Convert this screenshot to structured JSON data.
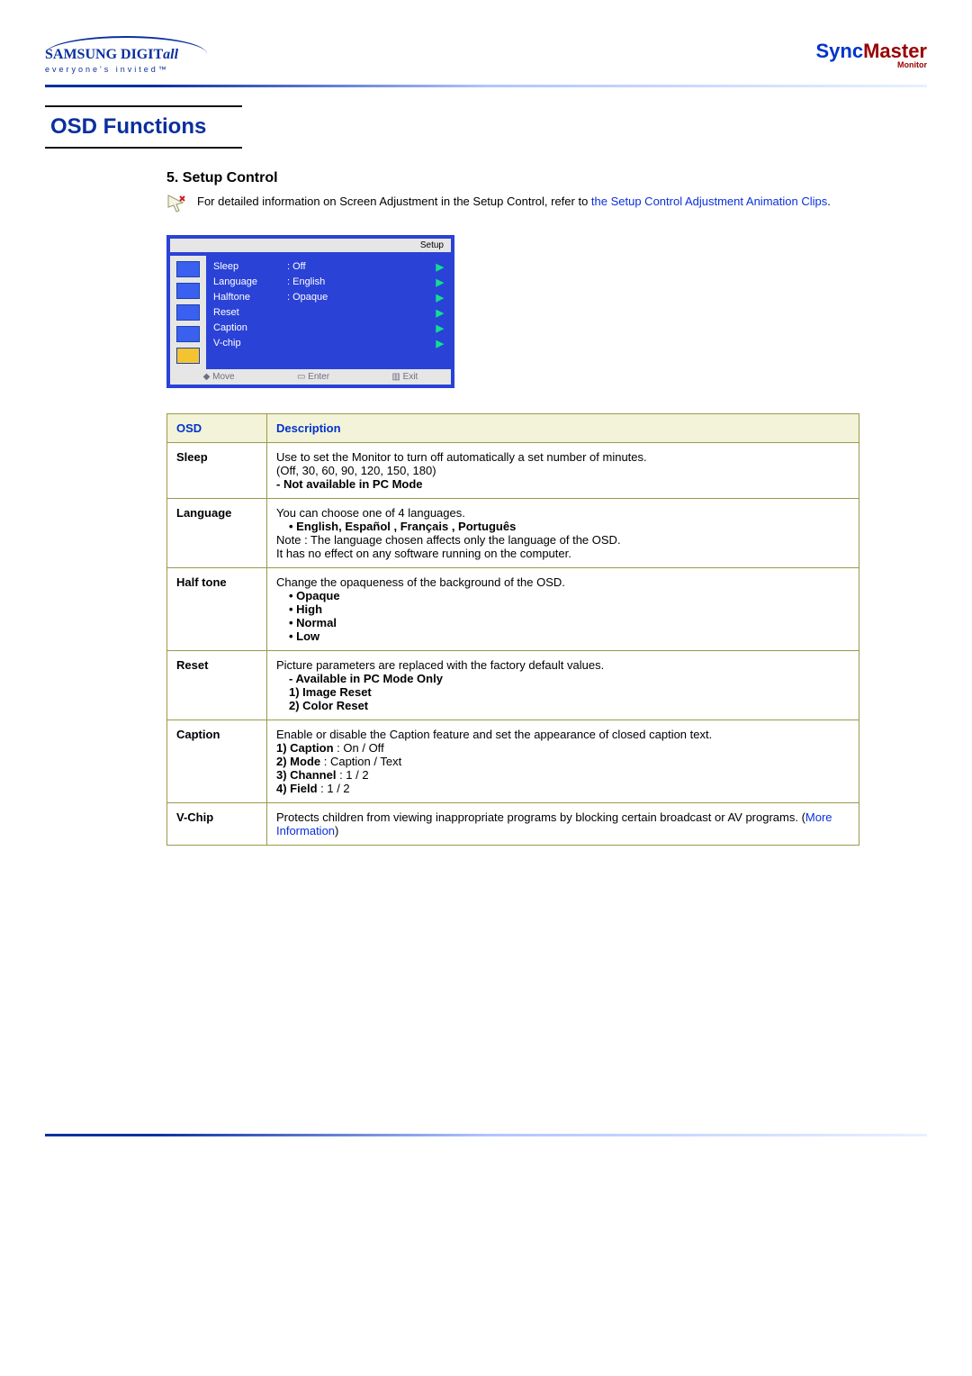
{
  "brand": {
    "samsung_text": "SAMSUNG DIGIT",
    "samsung_italic": "all",
    "samsung_tag": "everyone's invited™",
    "sync_a": "Sync",
    "sync_b": "Master",
    "sync_small": "Monitor"
  },
  "page_title": "OSD Functions",
  "section": {
    "heading": "5. Setup Control",
    "intro_plain": "For detailed information on Screen Adjustment in the Setup Control, refer to ",
    "intro_link": "the Setup Control Adjustment Animation Clips",
    "intro_period": "."
  },
  "osd_preview": {
    "panel_label": "Setup",
    "rows": [
      {
        "label": "Sleep",
        "value": ": Off"
      },
      {
        "label": "Language",
        "value": ": English"
      },
      {
        "label": "Halftone",
        "value": ": Opaque"
      },
      {
        "label": "Reset",
        "value": ""
      },
      {
        "label": "Caption",
        "value": ""
      },
      {
        "label": "V-chip",
        "value": ""
      }
    ],
    "footer": {
      "move": "Move",
      "enter": "Enter",
      "exit": "Exit"
    }
  },
  "table": {
    "header_osd": "OSD",
    "header_desc": "Description",
    "rows": [
      {
        "name": "Sleep",
        "lines": [
          {
            "t": "Use to set the Monitor to turn off automatically a set number of minutes."
          },
          {
            "t": "(Off, 30, 60, 90, 120, 150, 180)"
          },
          {
            "t": "- Not available in PC Mode",
            "b": true
          }
        ]
      },
      {
        "name": "Language",
        "lines": [
          {
            "t": "You can choose one of 4 languages."
          },
          {
            "t": "• English, Español , Français , Português",
            "b": true,
            "dot": true
          },
          {
            "t": "Note : The language chosen affects only the language of the OSD."
          },
          {
            "t": "It has no effect on any software running on the computer."
          }
        ]
      },
      {
        "name": "Half tone",
        "lines": [
          {
            "t": "Change the opaqueness of the background of the OSD."
          },
          {
            "t": "• Opaque",
            "b": true,
            "dot": true
          },
          {
            "t": "• High",
            "b": true,
            "dot": true
          },
          {
            "t": "• Normal",
            "b": true,
            "dot": true
          },
          {
            "t": "• Low",
            "b": true,
            "dot": true
          }
        ]
      },
      {
        "name": "Reset",
        "lines": [
          {
            "t": "Picture parameters are replaced with the factory default values."
          },
          {
            "t": "- Available in PC Mode Only",
            "b": true,
            "i1": true
          },
          {
            "t": "1) Image Reset",
            "b": true,
            "i1": true
          },
          {
            "t": "2) Color Reset",
            "b": true,
            "i1": true
          }
        ]
      },
      {
        "name": "Caption",
        "lines": [
          {
            "t": "Enable or disable the Caption feature and set the appearance of closed caption text."
          },
          {
            "b": true,
            "t": "1) Caption",
            "after": " : On / Off"
          },
          {
            "b": true,
            "t": "2) Mode",
            "after": " : Caption / Text"
          },
          {
            "b": true,
            "t": "3) Channel",
            "after": " : 1 / 2"
          },
          {
            "b": true,
            "t": "4) Field",
            "after": " : 1 / 2"
          }
        ]
      },
      {
        "name": "V-Chip",
        "lines": [
          {
            "t": "Protects children from viewing inappropriate programs by blocking certain broadcast or AV programs. (",
            "link": "More Information",
            "after": ")"
          }
        ]
      }
    ]
  }
}
